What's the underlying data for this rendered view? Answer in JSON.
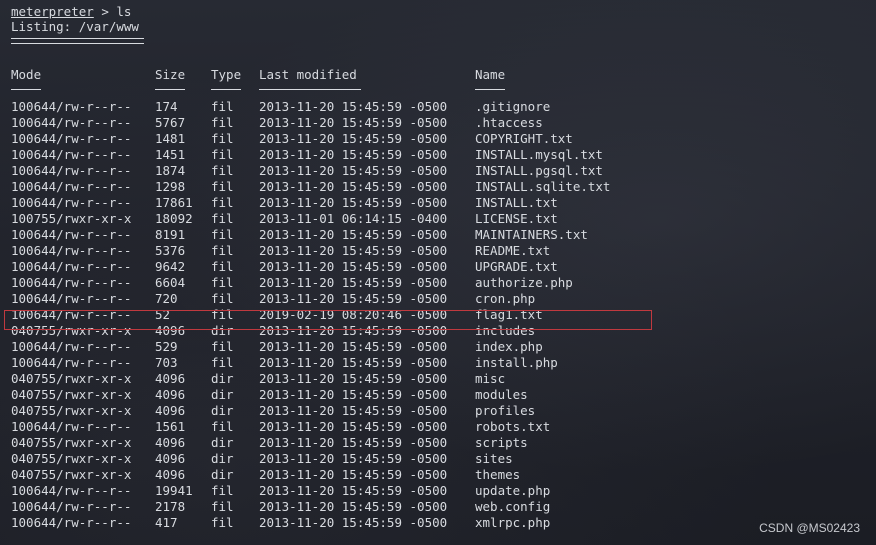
{
  "prompt": {
    "word": "meterpreter",
    "rest": " > ls"
  },
  "listing_title": "Listing: /var/www",
  "headers": {
    "mode": "Mode",
    "size": "Size",
    "type": "Type",
    "modified": "Last modified",
    "name": "Name"
  },
  "rows": [
    {
      "mode": "100644/rw-r--r--",
      "size": "174",
      "type": "fil",
      "modified": "2013-11-20 15:45:59 -0500",
      "name": ".gitignore"
    },
    {
      "mode": "100644/rw-r--r--",
      "size": "5767",
      "type": "fil",
      "modified": "2013-11-20 15:45:59 -0500",
      "name": ".htaccess"
    },
    {
      "mode": "100644/rw-r--r--",
      "size": "1481",
      "type": "fil",
      "modified": "2013-11-20 15:45:59 -0500",
      "name": "COPYRIGHT.txt"
    },
    {
      "mode": "100644/rw-r--r--",
      "size": "1451",
      "type": "fil",
      "modified": "2013-11-20 15:45:59 -0500",
      "name": "INSTALL.mysql.txt"
    },
    {
      "mode": "100644/rw-r--r--",
      "size": "1874",
      "type": "fil",
      "modified": "2013-11-20 15:45:59 -0500",
      "name": "INSTALL.pgsql.txt"
    },
    {
      "mode": "100644/rw-r--r--",
      "size": "1298",
      "type": "fil",
      "modified": "2013-11-20 15:45:59 -0500",
      "name": "INSTALL.sqlite.txt"
    },
    {
      "mode": "100644/rw-r--r--",
      "size": "17861",
      "type": "fil",
      "modified": "2013-11-20 15:45:59 -0500",
      "name": "INSTALL.txt"
    },
    {
      "mode": "100755/rwxr-xr-x",
      "size": "18092",
      "type": "fil",
      "modified": "2013-11-01 06:14:15 -0400",
      "name": "LICENSE.txt"
    },
    {
      "mode": "100644/rw-r--r--",
      "size": "8191",
      "type": "fil",
      "modified": "2013-11-20 15:45:59 -0500",
      "name": "MAINTAINERS.txt"
    },
    {
      "mode": "100644/rw-r--r--",
      "size": "5376",
      "type": "fil",
      "modified": "2013-11-20 15:45:59 -0500",
      "name": "README.txt"
    },
    {
      "mode": "100644/rw-r--r--",
      "size": "9642",
      "type": "fil",
      "modified": "2013-11-20 15:45:59 -0500",
      "name": "UPGRADE.txt"
    },
    {
      "mode": "100644/rw-r--r--",
      "size": "6604",
      "type": "fil",
      "modified": "2013-11-20 15:45:59 -0500",
      "name": "authorize.php"
    },
    {
      "mode": "100644/rw-r--r--",
      "size": "720",
      "type": "fil",
      "modified": "2013-11-20 15:45:59 -0500",
      "name": "cron.php"
    },
    {
      "mode": "100644/rw-r--r--",
      "size": "52",
      "type": "fil",
      "modified": "2019-02-19 08:20:46 -0500",
      "name": "flag1.txt"
    },
    {
      "mode": "040755/rwxr-xr-x",
      "size": "4096",
      "type": "dir",
      "modified": "2013-11-20 15:45:59 -0500",
      "name": "includes"
    },
    {
      "mode": "100644/rw-r--r--",
      "size": "529",
      "type": "fil",
      "modified": "2013-11-20 15:45:59 -0500",
      "name": "index.php"
    },
    {
      "mode": "100644/rw-r--r--",
      "size": "703",
      "type": "fil",
      "modified": "2013-11-20 15:45:59 -0500",
      "name": "install.php"
    },
    {
      "mode": "040755/rwxr-xr-x",
      "size": "4096",
      "type": "dir",
      "modified": "2013-11-20 15:45:59 -0500",
      "name": "misc"
    },
    {
      "mode": "040755/rwxr-xr-x",
      "size": "4096",
      "type": "dir",
      "modified": "2013-11-20 15:45:59 -0500",
      "name": "modules"
    },
    {
      "mode": "040755/rwxr-xr-x",
      "size": "4096",
      "type": "dir",
      "modified": "2013-11-20 15:45:59 -0500",
      "name": "profiles"
    },
    {
      "mode": "100644/rw-r--r--",
      "size": "1561",
      "type": "fil",
      "modified": "2013-11-20 15:45:59 -0500",
      "name": "robots.txt"
    },
    {
      "mode": "040755/rwxr-xr-x",
      "size": "4096",
      "type": "dir",
      "modified": "2013-11-20 15:45:59 -0500",
      "name": "scripts"
    },
    {
      "mode": "040755/rwxr-xr-x",
      "size": "4096",
      "type": "dir",
      "modified": "2013-11-20 15:45:59 -0500",
      "name": "sites"
    },
    {
      "mode": "040755/rwxr-xr-x",
      "size": "4096",
      "type": "dir",
      "modified": "2013-11-20 15:45:59 -0500",
      "name": "themes"
    },
    {
      "mode": "100644/rw-r--r--",
      "size": "19941",
      "type": "fil",
      "modified": "2013-11-20 15:45:59 -0500",
      "name": "update.php"
    },
    {
      "mode": "100644/rw-r--r--",
      "size": "2178",
      "type": "fil",
      "modified": "2013-11-20 15:45:59 -0500",
      "name": "web.config"
    },
    {
      "mode": "100644/rw-r--r--",
      "size": "417",
      "type": "fil",
      "modified": "2013-11-20 15:45:59 -0500",
      "name": "xmlrpc.php"
    }
  ],
  "watermark": "CSDN @MS02423",
  "colors": {
    "background": "#1f2129",
    "text": "#d8dbe0",
    "highlight_border": "#c0393f"
  }
}
